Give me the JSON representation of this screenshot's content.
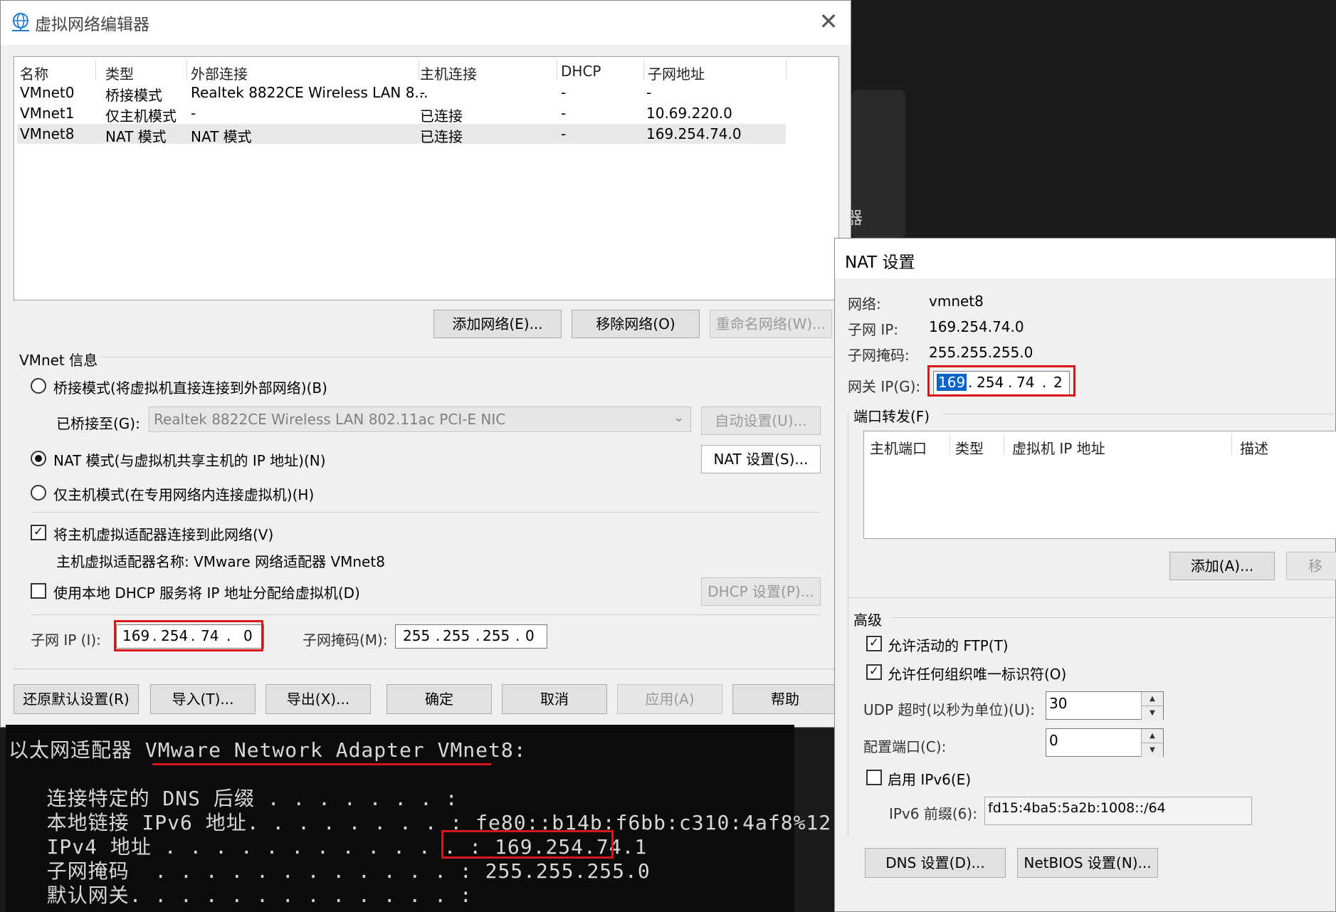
{
  "editor": {
    "title": "虚拟网络编辑器",
    "close": "✕",
    "columns": [
      "名称",
      "类型",
      "外部连接",
      "主机连接",
      "DHCP",
      "子网地址"
    ],
    "rows": [
      [
        "VMnet0",
        "桥接模式",
        "Realtek 8822CE Wireless LAN 8...",
        "-",
        "-",
        "-"
      ],
      [
        "VMnet1",
        "仅主机模式",
        "-",
        "已连接",
        "-",
        "10.69.220.0"
      ],
      [
        "VMnet8",
        "NAT 模式",
        "NAT 模式",
        "已连接",
        "-",
        "169.254.74.0"
      ]
    ],
    "selected_row": "VMnet8",
    "buttons": {
      "add": "添加网络(E)...",
      "remove": "移除网络(O)",
      "rename": "重命名网络(W)..."
    },
    "info_title": "VMnet 信息",
    "bridge_radio": "桥接模式(将虚拟机直接连接到外部网络)(B)",
    "bridged_to_label": "已桥接至(G):",
    "bridged_to_value": "Realtek 8822CE Wireless LAN 802.11ac PCI-E NIC",
    "auto_settings": "自动设置(U)...",
    "nat_radio": "NAT 模式(与虚拟机共享主机的 IP 地址)(N)",
    "nat_settings_btn": "NAT 设置(S)...",
    "hostonly_radio": "仅主机模式(在专用网络内连接虚拟机)(H)",
    "connect_adapter": "将主机虚拟适配器连接到此网络(V)",
    "adapter_name": "主机虚拟适配器名称: VMware 网络适配器 VMnet8",
    "dhcp_check": "使用本地 DHCP 服务将 IP 地址分配给虚拟机(D)",
    "dhcp_settings": "DHCP 设置(P)...",
    "subnet_ip_label": "子网 IP (I):",
    "subnet_ip": [
      "169",
      "254",
      "74",
      "0"
    ],
    "subnet_mask_label": "子网掩码(M):",
    "subnet_mask": [
      "255",
      "255",
      "255",
      "0"
    ],
    "bottom": {
      "restore": "还原默认设置(R)",
      "import": "导入(T)...",
      "export": "导出(X)...",
      "ok": "确定",
      "cancel": "取消",
      "apply": "应用(A)",
      "help": "帮助"
    }
  },
  "console": {
    "header_prefix": "以太网适配器 ",
    "header_name": "VMware Network Adapter VMnet8:",
    "lines": [
      {
        "label": "   连接特定的 DNS 后缀 . . . . . . . :",
        "value": ""
      },
      {
        "label": "   本地链接 IPv6 地址. . . . . . . . :",
        "value": " fe80::b14b:f6bb:c310:4af8%12"
      },
      {
        "label": "   IPv4 地址 . . . . . . . . . . . . :",
        "value": " 169.254.74.1"
      },
      {
        "label": "   子网掩码  . . . . . . . . . . . . :",
        "value": " 255.255.255.0"
      },
      {
        "label": "   默认网关. . . . . . . . . . . . . :",
        "value": ""
      }
    ]
  },
  "nat": {
    "title": "NAT 设置",
    "network_label": "网络:",
    "network": "vmnet8",
    "subnet_ip_label": "子网 IP:",
    "subnet_ip": "169.254.74.0",
    "subnet_mask_label": "子网掩码:",
    "subnet_mask": "255.255.255.0",
    "gateway_label": "网关 IP(G):",
    "gateway": [
      "169",
      "254",
      "74",
      "2"
    ],
    "port_forward_label": "端口转发(F)",
    "pf_columns": [
      "主机端口",
      "类型",
      "虚拟机 IP 地址",
      "描述"
    ],
    "pf_add": "添加(A)...",
    "pf_remove": "移除",
    "advanced_label": "高级",
    "allow_ftp": "允许活动的 FTP(T)",
    "allow_oui": "允许任何组织唯一标识符(O)",
    "udp_label": "UDP 超时(以秒为单位)(U):",
    "udp_value": "30",
    "config_port_label": "配置端口(C):",
    "config_port_value": "0",
    "ipv6_check": "启用 IPv6(E)",
    "ipv6_prefix_label": "IPv6 前缀(6):",
    "ipv6_prefix": "fd15:4ba5:5a2b:1008::/64",
    "dns_btn": "DNS 设置(D)...",
    "netbios_btn": "NetBIOS 设置(N)..."
  },
  "background_glyph": "器"
}
